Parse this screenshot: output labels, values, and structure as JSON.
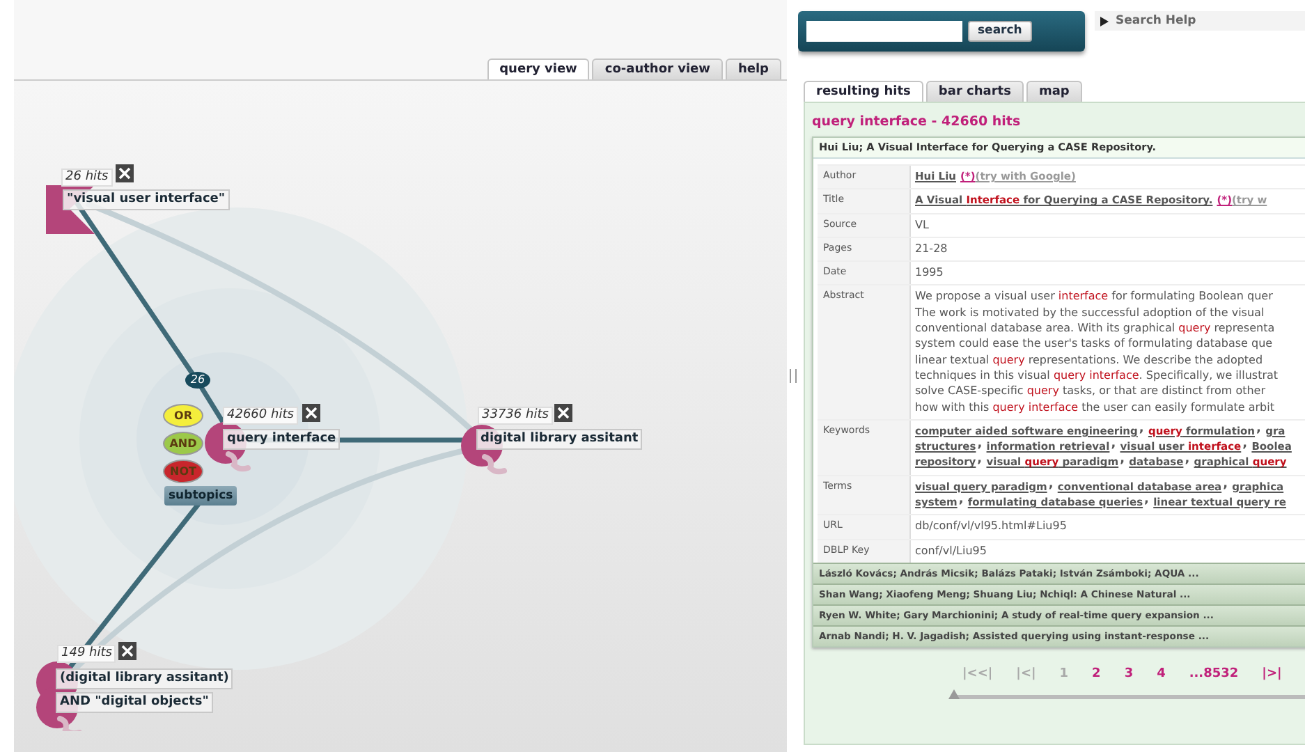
{
  "search": {
    "button": "search"
  },
  "search_help": {
    "label": "Search Help"
  },
  "view_tabs": [
    {
      "label": "query view",
      "selected": true
    },
    {
      "label": "co-author view",
      "selected": false
    },
    {
      "label": "help",
      "selected": false
    }
  ],
  "graph": {
    "edge_badge": "26",
    "subtopics_button": "subtopics",
    "operators": [
      {
        "label": "OR",
        "color": "#f4ee3c"
      },
      {
        "label": "AND",
        "color": "#9cc94a"
      },
      {
        "label": "NOT",
        "color": "#c8262c"
      }
    ],
    "nodes": [
      {
        "kind": "flag",
        "hits": "26 hits",
        "labels": [
          "\"visual user interface\""
        ]
      },
      {
        "kind": "circle",
        "hits": "42660 hits",
        "labels": [
          "query interface"
        ]
      },
      {
        "kind": "circle",
        "hits": "33736 hits",
        "labels": [
          "digital library assitant"
        ]
      },
      {
        "kind": "double",
        "hits": "149 hits",
        "labels": [
          "(digital library assitant)",
          "AND \"digital objects\""
        ]
      }
    ]
  },
  "results": {
    "tabs": [
      {
        "label": "resulting hits",
        "selected": true
      },
      {
        "label": "bar charts",
        "selected": false
      },
      {
        "label": "map",
        "selected": false
      }
    ],
    "heading": "query interface - 42660 hits",
    "record": {
      "title": "Hui Liu; A Visual Interface for Querying a CASE Repository.",
      "fields": [
        {
          "label": "Author",
          "lines": [
            [
              {
                "kind": "link",
                "parts": [
                  {
                    "text": "Hui Liu",
                    "hit": false
                  }
                ]
              },
              {
                "kind": "star",
                "parts": [
                  {
                    "text": "(*)",
                    "hit": false
                  }
                ]
              },
              {
                "kind": "ext",
                "parts": [
                  {
                    "text": "(try with Google)",
                    "hit": false
                  }
                ]
              }
            ]
          ]
        },
        {
          "label": "Title",
          "lines": [
            [
              {
                "kind": "link",
                "parts": [
                  {
                    "text": "A Visual ",
                    "hit": false
                  },
                  {
                    "text": "Interface",
                    "hit": true
                  },
                  {
                    "text": " for Querying a CASE Repository.",
                    "hit": false
                  }
                ]
              },
              {
                "kind": "star",
                "parts": [
                  {
                    "text": "(*)",
                    "hit": false
                  }
                ]
              },
              {
                "kind": "ext",
                "parts": [
                  {
                    "text": "(try w",
                    "hit": false
                  }
                ]
              }
            ]
          ]
        },
        {
          "label": "Source",
          "lines": [
            [
              {
                "kind": "plain",
                "parts": [
                  {
                    "text": "VL",
                    "hit": false
                  }
                ]
              }
            ]
          ]
        },
        {
          "label": "Pages",
          "lines": [
            [
              {
                "kind": "plain",
                "parts": [
                  {
                    "text": "21-28",
                    "hit": false
                  }
                ]
              }
            ]
          ]
        },
        {
          "label": "Date",
          "lines": [
            [
              {
                "kind": "plain",
                "parts": [
                  {
                    "text": "1995",
                    "hit": false
                  }
                ]
              }
            ]
          ]
        },
        {
          "label": "Abstract",
          "lines": [
            [
              {
                "kind": "plain",
                "parts": [
                  {
                    "text": "We propose a visual user ",
                    "hit": false
                  },
                  {
                    "text": "interface",
                    "hit": true
                  },
                  {
                    "text": " for formulating Boolean quer",
                    "hit": false
                  }
                ]
              }
            ],
            [
              {
                "kind": "plain",
                "parts": [
                  {
                    "text": "The work is motivated by the successful adoption of the visual",
                    "hit": false
                  }
                ]
              }
            ],
            [
              {
                "kind": "plain",
                "parts": [
                  {
                    "text": "conventional database area. With its graphical ",
                    "hit": false
                  },
                  {
                    "text": "query",
                    "hit": true
                  },
                  {
                    "text": " representa",
                    "hit": false
                  }
                ]
              }
            ],
            [
              {
                "kind": "plain",
                "parts": [
                  {
                    "text": "system could ease the user's tasks of formulating database que",
                    "hit": false
                  }
                ]
              }
            ],
            [
              {
                "kind": "plain",
                "parts": [
                  {
                    "text": "linear textual ",
                    "hit": false
                  },
                  {
                    "text": "query",
                    "hit": true
                  },
                  {
                    "text": " representations. We describe the adopted",
                    "hit": false
                  }
                ]
              }
            ],
            [
              {
                "kind": "plain",
                "parts": [
                  {
                    "text": "techniques in this visual ",
                    "hit": false
                  },
                  {
                    "text": "query interface",
                    "hit": true
                  },
                  {
                    "text": ". Specifically, we illustrat",
                    "hit": false
                  }
                ]
              }
            ],
            [
              {
                "kind": "plain",
                "parts": [
                  {
                    "text": "solve CASE-specific ",
                    "hit": false
                  },
                  {
                    "text": "query",
                    "hit": true
                  },
                  {
                    "text": " tasks, or that are distinct from other",
                    "hit": false
                  }
                ]
              }
            ],
            [
              {
                "kind": "plain",
                "parts": [
                  {
                    "text": "how with this ",
                    "hit": false
                  },
                  {
                    "text": "query interface",
                    "hit": true
                  },
                  {
                    "text": " the user can easily formulate arbit",
                    "hit": false
                  }
                ]
              }
            ]
          ]
        },
        {
          "label": "Keywords",
          "lines": [
            [
              {
                "kind": "link",
                "parts": [
                  {
                    "text": "computer aided software engineering",
                    "hit": false
                  }
                ]
              },
              {
                "kind": "sep",
                "parts": [
                  {
                    "text": ", ",
                    "hit": false
                  }
                ]
              },
              {
                "kind": "link",
                "parts": [
                  {
                    "text": "query",
                    "hit": true
                  },
                  {
                    "text": " formulation",
                    "hit": false
                  }
                ]
              },
              {
                "kind": "sep",
                "parts": [
                  {
                    "text": ", ",
                    "hit": false
                  }
                ]
              },
              {
                "kind": "link",
                "parts": [
                  {
                    "text": "gra",
                    "hit": false
                  }
                ]
              }
            ],
            [
              {
                "kind": "link",
                "parts": [
                  {
                    "text": "structures",
                    "hit": false
                  }
                ]
              },
              {
                "kind": "sep",
                "parts": [
                  {
                    "text": ", ",
                    "hit": false
                  }
                ]
              },
              {
                "kind": "link",
                "parts": [
                  {
                    "text": "information retrieval",
                    "hit": false
                  }
                ]
              },
              {
                "kind": "sep",
                "parts": [
                  {
                    "text": ", ",
                    "hit": false
                  }
                ]
              },
              {
                "kind": "link",
                "parts": [
                  {
                    "text": "visual user ",
                    "hit": false
                  },
                  {
                    "text": "interface",
                    "hit": true
                  }
                ]
              },
              {
                "kind": "sep",
                "parts": [
                  {
                    "text": ", ",
                    "hit": false
                  }
                ]
              },
              {
                "kind": "link",
                "parts": [
                  {
                    "text": "Boolea",
                    "hit": false
                  }
                ]
              }
            ],
            [
              {
                "kind": "link",
                "parts": [
                  {
                    "text": "repository",
                    "hit": false
                  }
                ]
              },
              {
                "kind": "sep",
                "parts": [
                  {
                    "text": ", ",
                    "hit": false
                  }
                ]
              },
              {
                "kind": "link",
                "parts": [
                  {
                    "text": "visual ",
                    "hit": false
                  },
                  {
                    "text": "query",
                    "hit": true
                  },
                  {
                    "text": " paradigm",
                    "hit": false
                  }
                ]
              },
              {
                "kind": "sep",
                "parts": [
                  {
                    "text": ", ",
                    "hit": false
                  }
                ]
              },
              {
                "kind": "link",
                "parts": [
                  {
                    "text": "database",
                    "hit": false
                  }
                ]
              },
              {
                "kind": "sep",
                "parts": [
                  {
                    "text": ", ",
                    "hit": false
                  }
                ]
              },
              {
                "kind": "link",
                "parts": [
                  {
                    "text": "graphical ",
                    "hit": false
                  },
                  {
                    "text": "query",
                    "hit": true
                  }
                ]
              }
            ]
          ]
        },
        {
          "label": "Terms",
          "lines": [
            [
              {
                "kind": "link",
                "parts": [
                  {
                    "text": "visual query paradigm",
                    "hit": false
                  }
                ]
              },
              {
                "kind": "sep",
                "parts": [
                  {
                    "text": ", ",
                    "hit": false
                  }
                ]
              },
              {
                "kind": "link",
                "parts": [
                  {
                    "text": "conventional database area",
                    "hit": false
                  }
                ]
              },
              {
                "kind": "sep",
                "parts": [
                  {
                    "text": ", ",
                    "hit": false
                  }
                ]
              },
              {
                "kind": "link",
                "parts": [
                  {
                    "text": "graphica",
                    "hit": false
                  }
                ]
              }
            ],
            [
              {
                "kind": "link",
                "parts": [
                  {
                    "text": "system",
                    "hit": false
                  }
                ]
              },
              {
                "kind": "sep",
                "parts": [
                  {
                    "text": ", ",
                    "hit": false
                  }
                ]
              },
              {
                "kind": "link",
                "parts": [
                  {
                    "text": "formulating database queries",
                    "hit": false
                  }
                ]
              },
              {
                "kind": "sep",
                "parts": [
                  {
                    "text": ", ",
                    "hit": false
                  }
                ]
              },
              {
                "kind": "link",
                "parts": [
                  {
                    "text": "linear textual query re",
                    "hit": false
                  }
                ]
              }
            ]
          ]
        },
        {
          "label": "URL",
          "lines": [
            [
              {
                "kind": "plain",
                "parts": [
                  {
                    "text": "db/conf/vl/vl95.html#Liu95",
                    "hit": false
                  }
                ]
              }
            ]
          ]
        },
        {
          "label": "DBLP Key",
          "lines": [
            [
              {
                "kind": "plain",
                "parts": [
                  {
                    "text": "conf/vl/Liu95",
                    "hit": false
                  }
                ]
              }
            ]
          ]
        }
      ]
    },
    "other_records": [
      "László Kovács; András Micsik; Balázs Pataki; István Zsámboki; AQUA ...",
      "Shan Wang; Xiaofeng Meng; Shuang Liu; Nchiql: A Chinese Natural ...",
      "Ryen W. White; Gary Marchionini; A study of real-time query expansion ...",
      "Arnab Nandi; H. V. Jagadish; Assisted querying using instant-response ..."
    ],
    "pagination": [
      {
        "label": "|<<|",
        "disabled": true
      },
      {
        "label": "|<|",
        "disabled": true
      },
      {
        "label": "1",
        "disabled": true
      },
      {
        "label": "2",
        "disabled": false
      },
      {
        "label": "3",
        "disabled": false
      },
      {
        "label": "4",
        "disabled": false
      },
      {
        "label": "...8532",
        "disabled": false
      },
      {
        "label": "|>|",
        "disabled": false
      }
    ],
    "slider": {
      "level": 0
    }
  }
}
